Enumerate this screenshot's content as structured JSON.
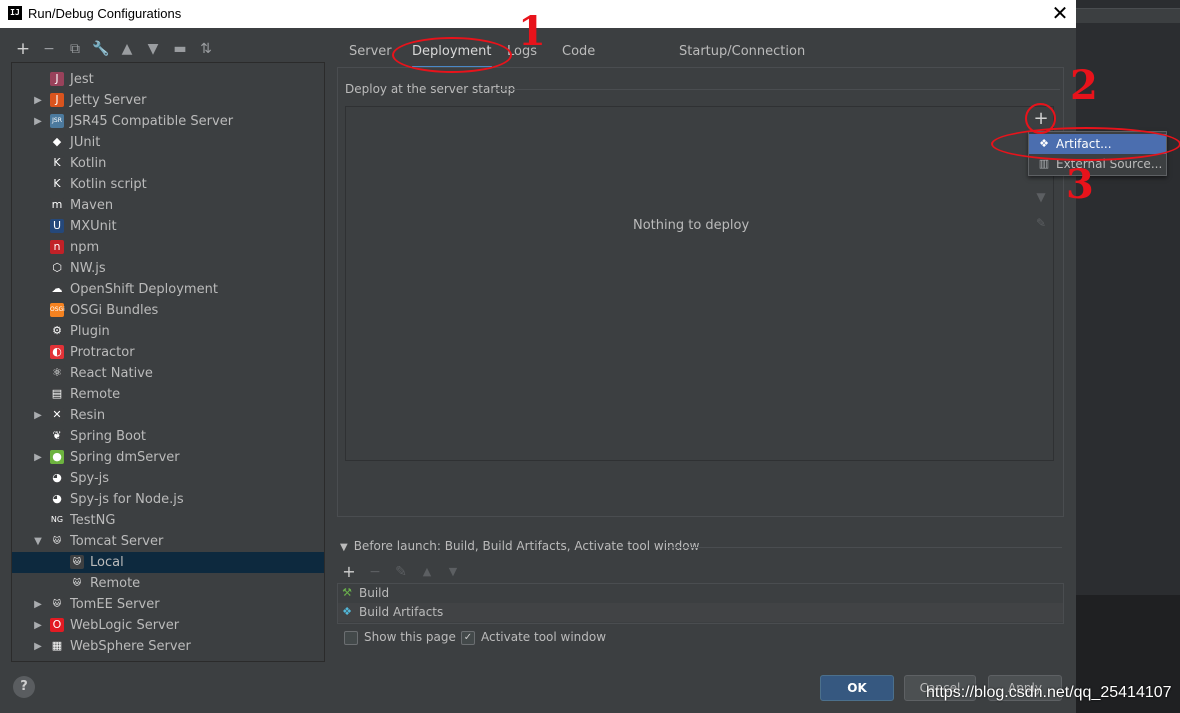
{
  "window": {
    "title": "Run/Debug Configurations",
    "app_icon": "IJ"
  },
  "toolbar": {
    "icons": [
      "add-icon",
      "remove-icon",
      "copy-icon",
      "wrench-icon",
      "move-up-icon",
      "move-down-icon",
      "folder-icon",
      "sort-icon"
    ]
  },
  "tree": {
    "items": [
      {
        "label": "Jest",
        "expandable": false,
        "icon": "jest-icon",
        "icon_text": "J",
        "color": "#99425b"
      },
      {
        "label": "Jetty Server",
        "expandable": true,
        "icon": "jetty-icon",
        "icon_text": "J",
        "color": "#d9541e"
      },
      {
        "label": "JSR45 Compatible Server",
        "expandable": true,
        "icon": "jsr45-icon",
        "icon_text": "JSR",
        "color": "#4c7a9e"
      },
      {
        "label": "JUnit",
        "expandable": false,
        "icon": "junit-icon",
        "icon_text": "◆",
        "color": "#3d3f41"
      },
      {
        "label": "Kotlin",
        "expandable": false,
        "icon": "kotlin-icon",
        "icon_text": "K",
        "color": "#3d3f41"
      },
      {
        "label": "Kotlin script",
        "expandable": false,
        "icon": "kotlin-script-icon",
        "icon_text": "K",
        "color": "#3d3f41"
      },
      {
        "label": "Maven",
        "expandable": false,
        "icon": "maven-icon",
        "icon_text": "m",
        "color": "#3d3f41"
      },
      {
        "label": "MXUnit",
        "expandable": false,
        "icon": "mxunit-icon",
        "icon_text": "U",
        "color": "#25487a"
      },
      {
        "label": "npm",
        "expandable": false,
        "icon": "npm-icon",
        "icon_text": "n",
        "color": "#c12127"
      },
      {
        "label": "NW.js",
        "expandable": false,
        "icon": "nwjs-icon",
        "icon_text": "⬡",
        "color": "#3d3f41"
      },
      {
        "label": "OpenShift Deployment",
        "expandable": false,
        "icon": "openshift-icon",
        "icon_text": "☁",
        "color": "#3d3f41"
      },
      {
        "label": "OSGi Bundles",
        "expandable": false,
        "icon": "osgi-icon",
        "icon_text": "OSGi",
        "color": "#f58220"
      },
      {
        "label": "Plugin",
        "expandable": false,
        "icon": "plugin-icon",
        "icon_text": "⚙",
        "color": "#3d3f41"
      },
      {
        "label": "Protractor",
        "expandable": false,
        "icon": "protractor-icon",
        "icon_text": "◐",
        "color": "#e23237"
      },
      {
        "label": "React Native",
        "expandable": false,
        "icon": "react-icon",
        "icon_text": "⚛",
        "color": "#3d3f41"
      },
      {
        "label": "Remote",
        "expandable": false,
        "icon": "remote-icon",
        "icon_text": "▤",
        "color": "#3d3f41"
      },
      {
        "label": "Resin",
        "expandable": true,
        "icon": "resin-icon",
        "icon_text": "✕",
        "color": "#3d3f41"
      },
      {
        "label": "Spring Boot",
        "expandable": false,
        "icon": "spring-boot-icon",
        "icon_text": "❦",
        "color": "#3d3f41"
      },
      {
        "label": "Spring dmServer",
        "expandable": true,
        "icon": "spring-dm-icon",
        "icon_text": "●",
        "color": "#6db33f"
      },
      {
        "label": "Spy-js",
        "expandable": false,
        "icon": "spyjs-icon",
        "icon_text": "◕",
        "color": "#3d3f41"
      },
      {
        "label": "Spy-js for Node.js",
        "expandable": false,
        "icon": "spyjs-node-icon",
        "icon_text": "◕",
        "color": "#3d3f41"
      },
      {
        "label": "TestNG",
        "expandable": false,
        "icon": "testng-icon",
        "icon_text": "NG",
        "color": "#3d3f41"
      },
      {
        "label": "Tomcat Server",
        "expandable": true,
        "expanded": true,
        "icon": "tomcat-icon",
        "icon_text": "🐱",
        "color": "#3d3f41"
      },
      {
        "label": "Local",
        "expandable": false,
        "selected": true,
        "child": true,
        "icon": "tomcat-local-icon",
        "icon_text": "🐱",
        "color": "#3d3f41"
      },
      {
        "label": "Remote",
        "expandable": false,
        "child": true,
        "icon": "tomcat-remote-icon",
        "icon_text": "🐱",
        "color": "#3d3f41"
      },
      {
        "label": "TomEE Server",
        "expandable": true,
        "icon": "tomee-icon",
        "icon_text": "🐱",
        "color": "#3d3f41"
      },
      {
        "label": "WebLogic Server",
        "expandable": true,
        "icon": "weblogic-icon",
        "icon_text": "O",
        "color": "#e21b23"
      },
      {
        "label": "WebSphere Server",
        "expandable": true,
        "icon": "websphere-icon",
        "icon_text": "▦",
        "color": "#3d3f41"
      }
    ]
  },
  "tabs": [
    {
      "label": "Server",
      "active": false
    },
    {
      "label": "Deployment",
      "active": true
    },
    {
      "label": "Logs",
      "active": false
    },
    {
      "label": "Code Coverage",
      "active": false
    },
    {
      "label": "Startup/Connection",
      "active": false
    }
  ],
  "deployment": {
    "section_title": "Deploy at the server startup",
    "empty_text": "Nothing to deploy",
    "popup_items": [
      {
        "label": "Artifact...",
        "highlighted": true,
        "icon": "artifact-icon"
      },
      {
        "label": "External Source...",
        "highlighted": false,
        "icon": "external-source-icon"
      }
    ]
  },
  "before_launch": {
    "title": "Before launch: Build, Build Artifacts, Activate tool window",
    "items": [
      {
        "label": "Build",
        "icon": "hammer-icon"
      },
      {
        "label": "Build Artifacts",
        "icon": "artifact-icon"
      }
    ]
  },
  "options": {
    "show_this_page": {
      "label": "Show this page",
      "checked": false
    },
    "activate_tool_window": {
      "label": "Activate tool window",
      "checked": true
    }
  },
  "buttons": {
    "ok": "OK",
    "cancel": "Cancel",
    "apply": "Apply",
    "help": "?"
  },
  "annotations": {
    "n1": "1",
    "n2": "2",
    "n3": "3"
  },
  "watermark": "https://blog.csdn.net/qq_25414107"
}
